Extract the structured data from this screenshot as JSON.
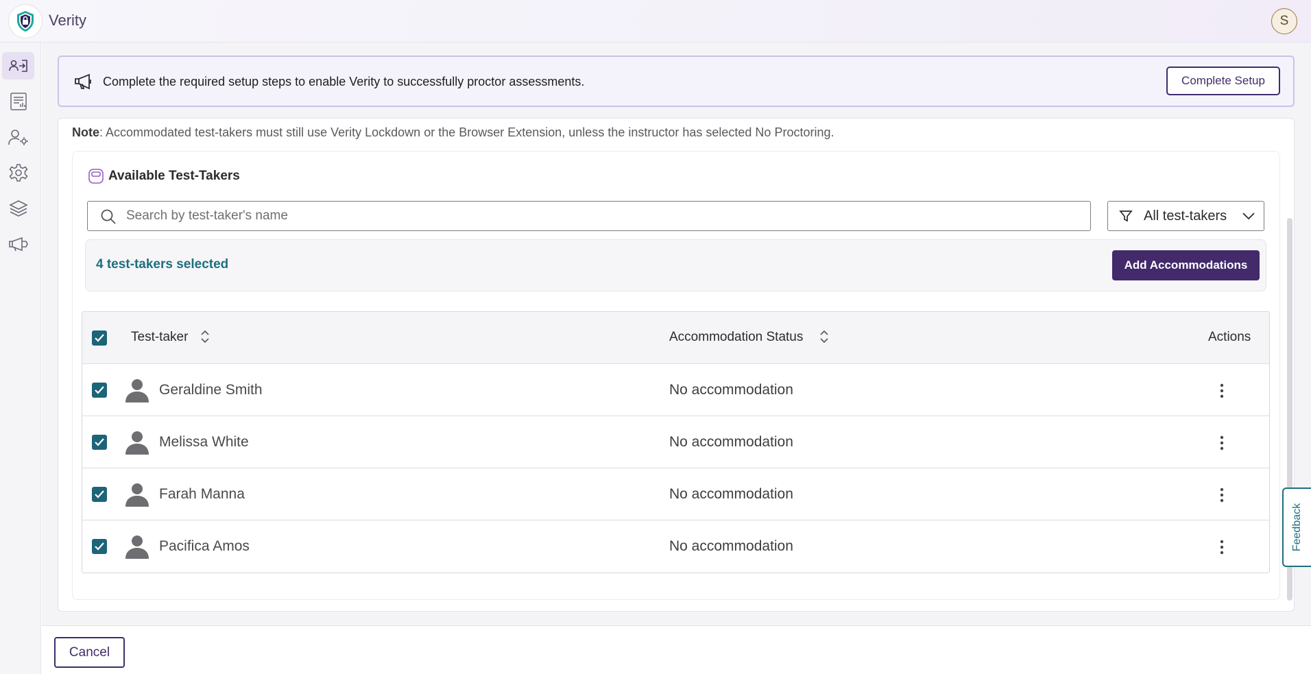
{
  "app": {
    "title": "Verity",
    "user_initial": "S"
  },
  "sidebar": {
    "items": [
      {
        "icon": "user-login-icon",
        "active": true
      },
      {
        "icon": "report-icon",
        "active": false
      },
      {
        "icon": "user-settings-icon",
        "active": false
      },
      {
        "icon": "gear-icon",
        "active": false
      },
      {
        "icon": "layers-icon",
        "active": false
      },
      {
        "icon": "announcement-icon",
        "active": false
      }
    ]
  },
  "banner": {
    "text": "Complete the required setup steps to enable Verity to successfully proctor assessments.",
    "button_label": "Complete Setup"
  },
  "note": {
    "label": "Note",
    "text": ": Accommodated test-takers must still use Verity Lockdown or the Browser Extension, unless the instructor has selected No Proctoring."
  },
  "section": {
    "title": "Available Test-Takers"
  },
  "search": {
    "placeholder": "Search by test-taker's name",
    "value": ""
  },
  "filter": {
    "selected": "All test-takers"
  },
  "selection": {
    "count_text": "4 test-takers selected",
    "button_label": "Add Accommodations"
  },
  "table": {
    "headers": {
      "name": "Test-taker",
      "status": "Accommodation Status",
      "actions": "Actions"
    },
    "rows": [
      {
        "name": "Geraldine Smith",
        "status": "No accommodation",
        "checked": true
      },
      {
        "name": "Melissa White",
        "status": "No accommodation",
        "checked": true
      },
      {
        "name": "Farah Manna",
        "status": "No accommodation",
        "checked": true
      },
      {
        "name": "Pacifica Amos",
        "status": "No accommodation",
        "checked": true
      }
    ]
  },
  "feedback": {
    "label": "Feedback"
  },
  "footer": {
    "cancel_label": "Cancel"
  },
  "colors": {
    "brand": "#422a6b",
    "accent": "#1d6478",
    "teal_text": "#1d6f7e",
    "banner_border": "#c9c2e9"
  }
}
